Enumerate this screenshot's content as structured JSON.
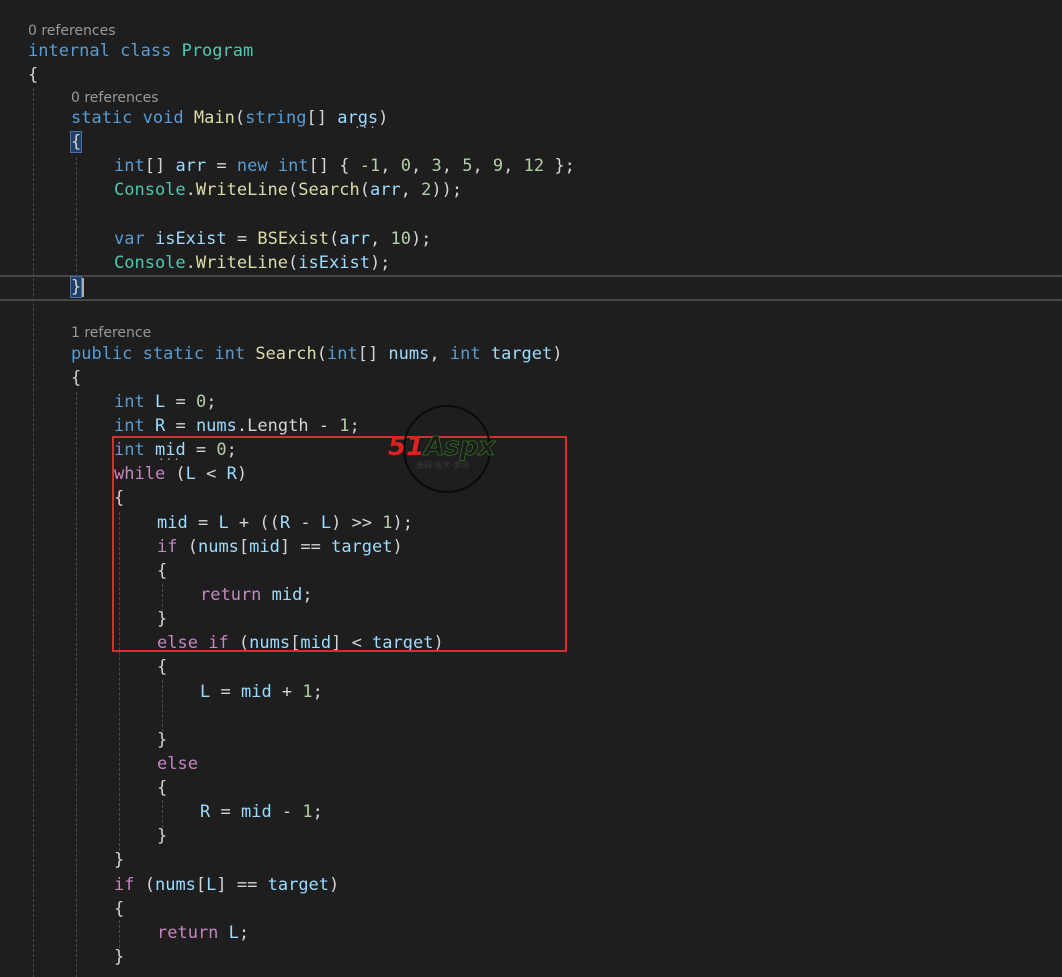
{
  "codelens": {
    "class_refs": "0 references",
    "main_refs": "0 references",
    "search_refs": "1 reference"
  },
  "code": {
    "class_decl": {
      "k1": "internal",
      "k2": "class",
      "name": "Program"
    },
    "main_decl": {
      "k1": "static",
      "k2": "void",
      "name": "Main",
      "type": "string",
      "arg": "args"
    },
    "arr_decl": {
      "type": "int",
      "name": "arr",
      "new": "new",
      "type2": "int",
      "v1": "-1",
      "v2": "0",
      "v3": "3",
      "v4": "5",
      "v5": "9",
      "v6": "12"
    },
    "writeline1": {
      "cls": "Console",
      "fn": "WriteLine",
      "inner": "Search",
      "arg1": "arr",
      "arg2": "2"
    },
    "isexist_decl": {
      "var": "var",
      "name": "isExist",
      "fn": "BSExist",
      "arg1": "arr",
      "arg2": "10"
    },
    "writeline2": {
      "cls": "Console",
      "fn": "WriteLine",
      "arg": "isExist"
    },
    "search_decl": {
      "k1": "public",
      "k2": "static",
      "k3": "int",
      "name": "Search",
      "t1": "int",
      "p1": "nums",
      "t2": "int",
      "p2": "target"
    },
    "l_decl": {
      "type": "int",
      "name": "L",
      "val": "0"
    },
    "r_decl": {
      "type": "int",
      "name": "R",
      "arr": "nums",
      "prop": "Length",
      "val": "1"
    },
    "mid_decl": {
      "type": "int",
      "name": "mid",
      "val": "0"
    },
    "while_line": {
      "kw": "while",
      "a": "L",
      "b": "R"
    },
    "mid_calc": {
      "name": "mid",
      "a": "L",
      "b": "R",
      "c": "L",
      "n": "1"
    },
    "if1": {
      "kw": "if",
      "arr": "nums",
      "idx": "mid",
      "t": "target"
    },
    "ret_mid": {
      "kw": "return",
      "v": "mid"
    },
    "elseif": {
      "k1": "else",
      "k2": "if",
      "arr": "nums",
      "idx": "mid",
      "t": "target"
    },
    "l_assign": {
      "a": "L",
      "b": "mid",
      "n": "1"
    },
    "else_kw": "else",
    "r_assign": {
      "a": "R",
      "b": "mid",
      "n": "1"
    },
    "if2": {
      "kw": "if",
      "arr": "nums",
      "idx": "L",
      "t": "target"
    },
    "ret_l": {
      "kw": "return",
      "v": "L"
    }
  },
  "watermark": {
    "brand_red": "51",
    "brand_rest": "Aspx",
    "sub": "源码·技术·资讯"
  },
  "colors": {
    "background": "#1e1e1e",
    "keyword": "#569cd6",
    "control": "#c586c0",
    "type": "#4ec9b0",
    "function": "#dcdcaa",
    "variable": "#9cdcfe",
    "number": "#b5cea8",
    "highlight_box": "#d32f2f"
  }
}
